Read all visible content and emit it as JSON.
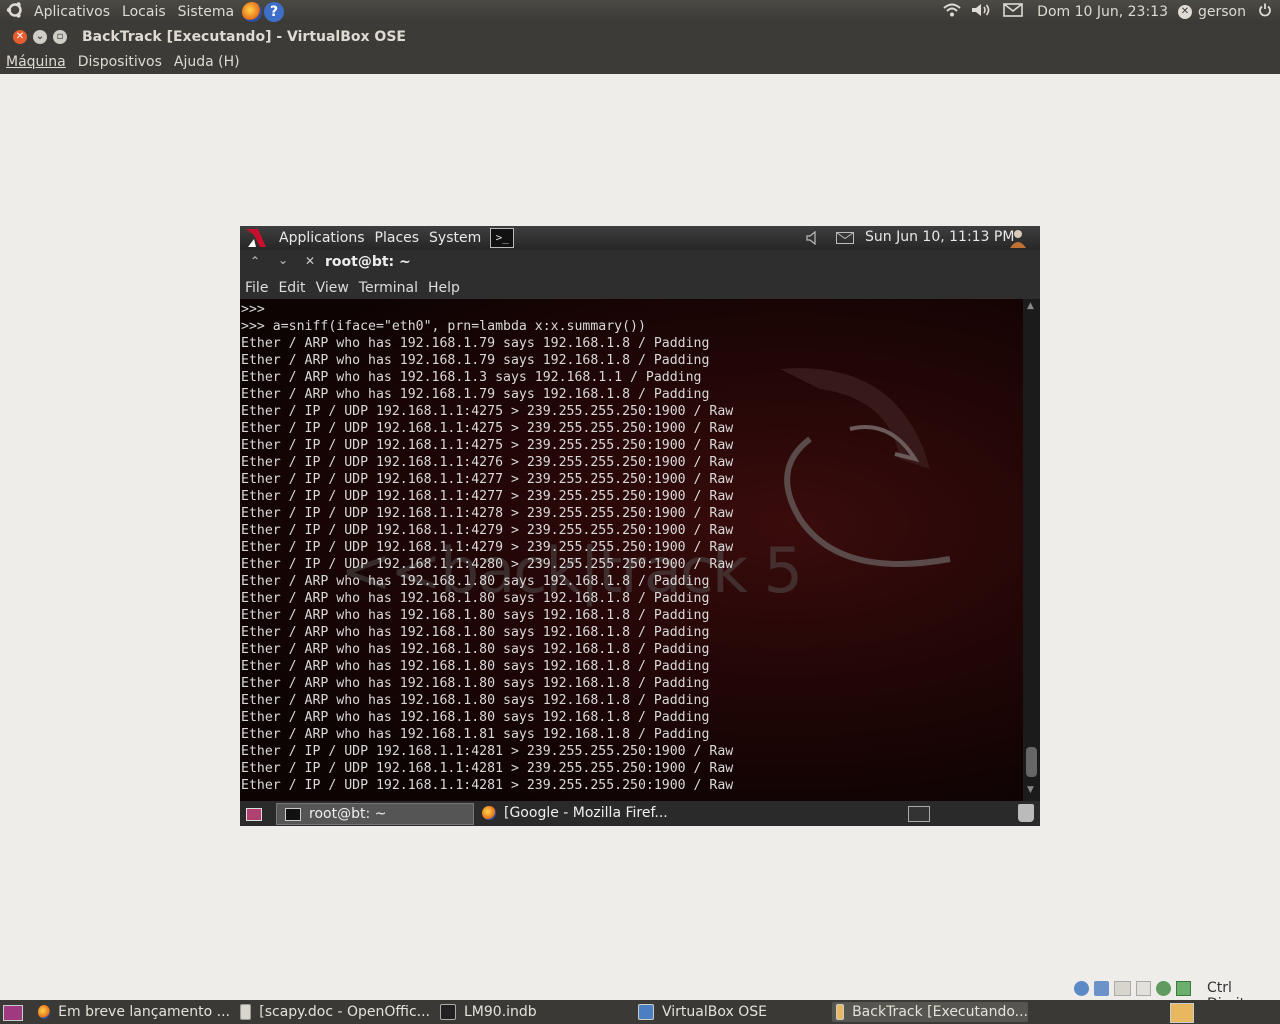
{
  "host_panel": {
    "menus": [
      "Aplicativos",
      "Locais",
      "Sistema"
    ],
    "datetime": "Dom 10 Jun, 23:13",
    "user": "gerson"
  },
  "vbox": {
    "title": "BackTrack [Executando] - VirtualBox OSE",
    "menu": {
      "machine": "Máquina",
      "devices": "Dispositivos",
      "help": "Ajuda (H)"
    },
    "host_key": "Ctrl Direito"
  },
  "guest_panel": {
    "menus": [
      "Applications",
      "Places",
      "System"
    ],
    "datetime": "Sun Jun 10, 11:13 PM"
  },
  "terminal": {
    "title": "root@bt: ~",
    "menu": [
      "File",
      "Edit",
      "View",
      "Terminal",
      "Help"
    ],
    "lines": [
      ">>>",
      ">>> a=sniff(iface=\"eth0\", prn=lambda x:x.summary())",
      "Ether / ARP who has 192.168.1.79 says 192.168.1.8 / Padding",
      "Ether / ARP who has 192.168.1.79 says 192.168.1.8 / Padding",
      "Ether / ARP who has 192.168.1.3 says 192.168.1.1 / Padding",
      "Ether / ARP who has 192.168.1.79 says 192.168.1.8 / Padding",
      "Ether / IP / UDP 192.168.1.1:4275 > 239.255.255.250:1900 / Raw",
      "Ether / IP / UDP 192.168.1.1:4275 > 239.255.255.250:1900 / Raw",
      "Ether / IP / UDP 192.168.1.1:4275 > 239.255.255.250:1900 / Raw",
      "Ether / IP / UDP 192.168.1.1:4276 > 239.255.255.250:1900 / Raw",
      "Ether / IP / UDP 192.168.1.1:4277 > 239.255.255.250:1900 / Raw",
      "Ether / IP / UDP 192.168.1.1:4277 > 239.255.255.250:1900 / Raw",
      "Ether / IP / UDP 192.168.1.1:4278 > 239.255.255.250:1900 / Raw",
      "Ether / IP / UDP 192.168.1.1:4279 > 239.255.255.250:1900 / Raw",
      "Ether / IP / UDP 192.168.1.1:4279 > 239.255.255.250:1900 / Raw",
      "Ether / IP / UDP 192.168.1.1:4280 > 239.255.255.250:1900 / Raw",
      "Ether / ARP who has 192.168.1.80 says 192.168.1.8 / Padding",
      "Ether / ARP who has 192.168.1.80 says 192.168.1.8 / Padding",
      "Ether / ARP who has 192.168.1.80 says 192.168.1.8 / Padding",
      "Ether / ARP who has 192.168.1.80 says 192.168.1.8 / Padding",
      "Ether / ARP who has 192.168.1.80 says 192.168.1.8 / Padding",
      "Ether / ARP who has 192.168.1.80 says 192.168.1.8 / Padding",
      "Ether / ARP who has 192.168.1.80 says 192.168.1.8 / Padding",
      "Ether / ARP who has 192.168.1.80 says 192.168.1.8 / Padding",
      "Ether / ARP who has 192.168.1.80 says 192.168.1.8 / Padding",
      "Ether / ARP who has 192.168.1.81 says 192.168.1.8 / Padding",
      "Ether / IP / UDP 192.168.1.1:4281 > 239.255.255.250:1900 / Raw",
      "Ether / IP / UDP 192.168.1.1:4281 > 239.255.255.250:1900 / Raw",
      "Ether / IP / UDP 192.168.1.1:4281 > 239.255.255.250:1900 / Raw"
    ],
    "wallpaper_text": "<<back|track 5"
  },
  "guest_taskbar": {
    "tasks": [
      "root@bt: ~",
      "[Google - Mozilla Firef..."
    ]
  },
  "host_taskbar": {
    "tasks": [
      "Em breve lançamento ...",
      "[scapy.doc - OpenOffic...",
      "LM90.indb",
      "VirtualBox OSE",
      "BackTrack [Executando..."
    ]
  },
  "colors": {
    "host_panel_bg": "#3c3b37",
    "terminal_text": "#d9d9d9",
    "terminal_bg": "#220606",
    "close_button": "#e45e2f"
  }
}
